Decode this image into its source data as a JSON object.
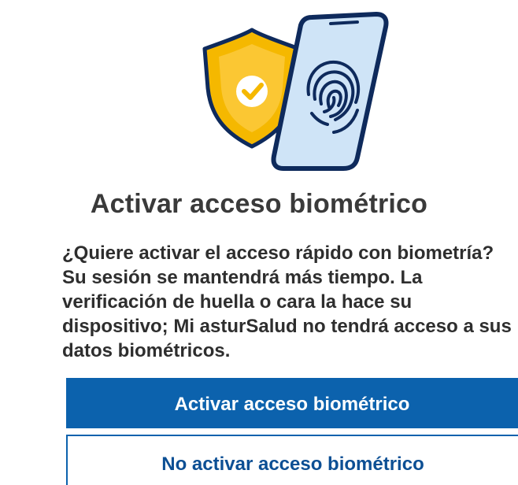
{
  "dialog": {
    "title": "Activar acceso biométrico",
    "description_lines": [
      "¿Quiere activar el acceso rápido con biometría?",
      "Su sesión se mantendrá más tiempo. La",
      "verificación de huella o cara la hace su",
      "dispositivo; Mi asturSalud no tendrá acceso a sus",
      "datos biométricos."
    ],
    "activate_label": "Activar acceso biométrico",
    "decline_label": "No activar acceso biométrico"
  },
  "icons": {
    "shield": "shield-check-icon",
    "phone": "phone-fingerprint-icon"
  },
  "colors": {
    "primary_blue": "#0c62ad",
    "shield_yellow": "#f5b800",
    "phone_screen": "#cfe4f7",
    "text_dark": "#2e2e2e"
  }
}
